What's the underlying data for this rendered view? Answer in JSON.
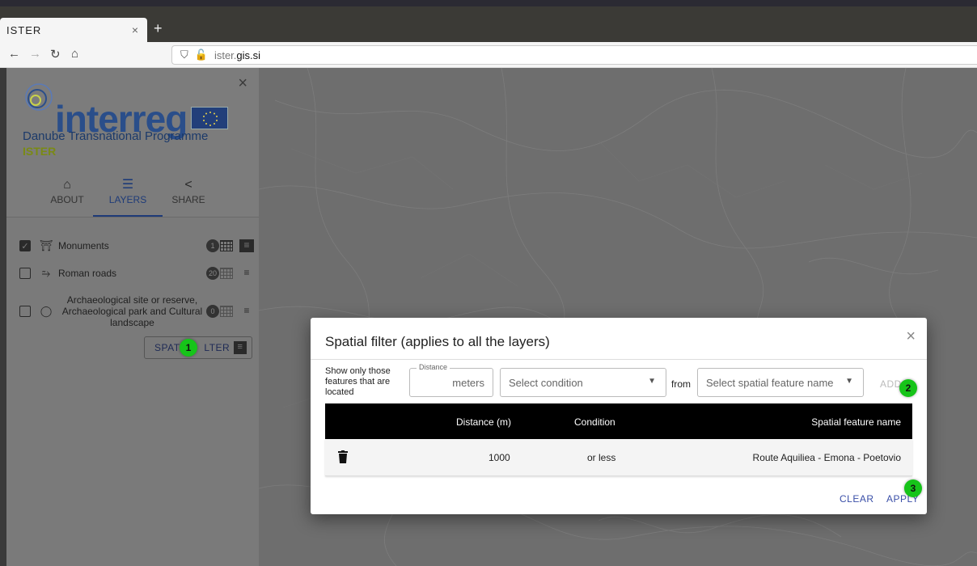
{
  "browser": {
    "tab_title": "ISTER",
    "tab_close": "×",
    "new_tab": "+",
    "url_domain_prefix": "ister.",
    "url_domain_main": "gis.si"
  },
  "sidebar": {
    "close": "×",
    "logo_word": "interreg",
    "programme": "Danube Transnational Programme",
    "project": "ISTER",
    "tabs": [
      {
        "label": "ABOUT",
        "icon": "home-icon"
      },
      {
        "label": "LAYERS",
        "icon": "list-icon"
      },
      {
        "label": "SHARE",
        "icon": "share-icon"
      }
    ],
    "layers": [
      {
        "label": "Monuments",
        "checked": true,
        "badge": "1",
        "icon": "monument-icon"
      },
      {
        "label": "Roman roads",
        "checked": false,
        "badge": "20",
        "icon": "road-icon"
      },
      {
        "label": "Archaeological site or reserve, Archaeological park and Cultural landscape",
        "checked": false,
        "badge": "0",
        "icon": "site-icon"
      }
    ],
    "spatial_filter_button_left": "SPATI",
    "spatial_filter_button_right": "LTER"
  },
  "markers": {
    "m1": "1",
    "m2": "2",
    "m3": "3"
  },
  "dialog": {
    "title": "Spatial filter (applies to all the layers)",
    "close": "×",
    "show_label": "Show only those features that are located",
    "distance_legend": "Distance",
    "distance_unit": "meters",
    "condition_placeholder": "Select condition",
    "from_label": "from",
    "feature_placeholder": "Select spatial feature name",
    "add_label": "ADD",
    "table": {
      "headers": [
        "Distance (m)",
        "Condition",
        "Spatial feature name"
      ],
      "rows": [
        {
          "distance": "1000",
          "condition": "or less",
          "feature": "Route Aquiliea - Emona - Poetovio"
        }
      ]
    },
    "clear_label": "CLEAR",
    "apply_label": "APPLY"
  }
}
